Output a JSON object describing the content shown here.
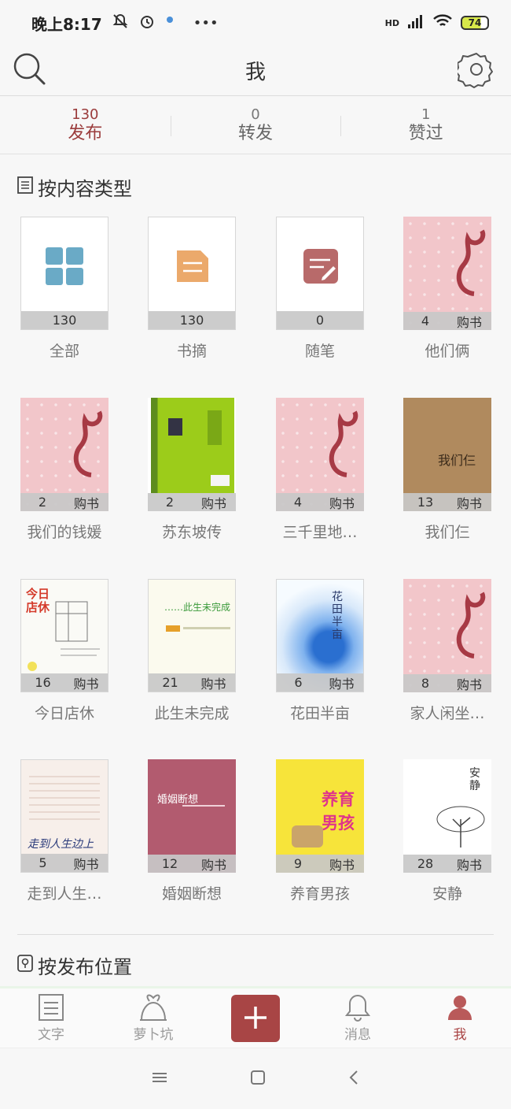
{
  "status_bar": {
    "time": "晚上8:17",
    "network": "HD",
    "battery": "74"
  },
  "header": {
    "title": "我"
  },
  "stats": [
    {
      "count": "130",
      "label": "发布",
      "active": true
    },
    {
      "count": "0",
      "label": "转发",
      "active": false
    },
    {
      "count": "1",
      "label": "赞过",
      "active": false
    }
  ],
  "section_by_type": {
    "title": "按内容类型"
  },
  "section_by_location": {
    "title": "按发布位置"
  },
  "buy_label": "购书",
  "items": [
    {
      "count": "130",
      "name": "全部",
      "icon": "grid-icon"
    },
    {
      "count": "130",
      "name": "书摘",
      "icon": "note-icon"
    },
    {
      "count": "0",
      "name": "随笔",
      "icon": "edit-icon"
    },
    {
      "count": "4",
      "name": "他们俩",
      "cover": "pink-placeholder"
    },
    {
      "count": "2",
      "name": "我们的钱媛",
      "cover": "pink-placeholder"
    },
    {
      "count": "2",
      "name": "苏东坡传",
      "cover": "green-book"
    },
    {
      "count": "4",
      "name": "三千里地…",
      "cover": "pink-placeholder"
    },
    {
      "count": "13",
      "name": "我们仨",
      "cover": "brown-book",
      "cover_text": "我们仨"
    },
    {
      "count": "16",
      "name": "今日店休",
      "cover": "sketch-book",
      "cover_text": "今日店休"
    },
    {
      "count": "21",
      "name": "此生未完成",
      "cover": "cream-book",
      "cover_text": "……此生未完成"
    },
    {
      "count": "6",
      "name": "花田半亩",
      "cover": "blue-flower-book",
      "cover_text": "花田半亩"
    },
    {
      "count": "8",
      "name": "家人闲坐…",
      "cover": "pink-placeholder"
    },
    {
      "count": "5",
      "name": "走到人生…",
      "cover": "script-book",
      "cover_text": "走到人生边上"
    },
    {
      "count": "12",
      "name": "婚姻断想",
      "cover": "mauve-book",
      "cover_text": "婚姻断想"
    },
    {
      "count": "9",
      "name": "养育男孩",
      "cover": "yellow-book",
      "cover_text": "养育男孩"
    },
    {
      "count": "28",
      "name": "安静",
      "cover": "tree-book",
      "cover_text": "安静"
    }
  ],
  "bottom_nav": [
    {
      "label": "文字",
      "icon": "document-icon",
      "active": false
    },
    {
      "label": "萝卜坑",
      "icon": "radish-icon",
      "active": false
    },
    {
      "label": "",
      "icon": "plus-icon",
      "active": false
    },
    {
      "label": "消息",
      "icon": "bell-icon",
      "active": false
    },
    {
      "label": "我",
      "icon": "person-icon",
      "active": true
    }
  ],
  "colors": {
    "accent": "#a84545",
    "pink_cover": "#f2c6ca"
  }
}
